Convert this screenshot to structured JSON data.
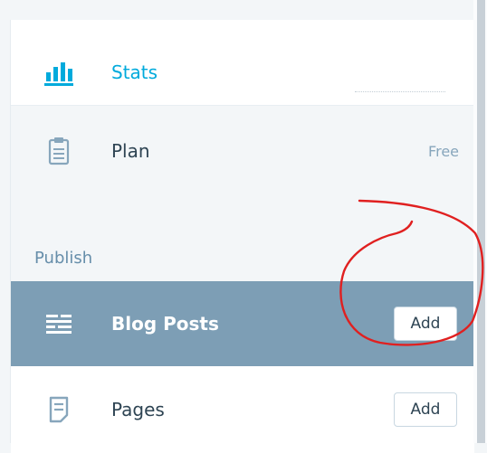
{
  "sidebar": {
    "stats": {
      "label": "Stats",
      "icon": "bar-chart-icon"
    },
    "plan": {
      "label": "Plan",
      "badge": "Free",
      "icon": "clipboard-icon"
    },
    "publish_header": "Publish",
    "blog_posts": {
      "label": "Blog Posts",
      "action": "Add",
      "icon": "lines-list-icon"
    },
    "pages": {
      "label": "Pages",
      "action": "Add",
      "icon": "page-icon"
    }
  },
  "colors": {
    "accent": "#00aadc",
    "selected_bg": "#7d9eb5",
    "annotation": "#e02020"
  }
}
